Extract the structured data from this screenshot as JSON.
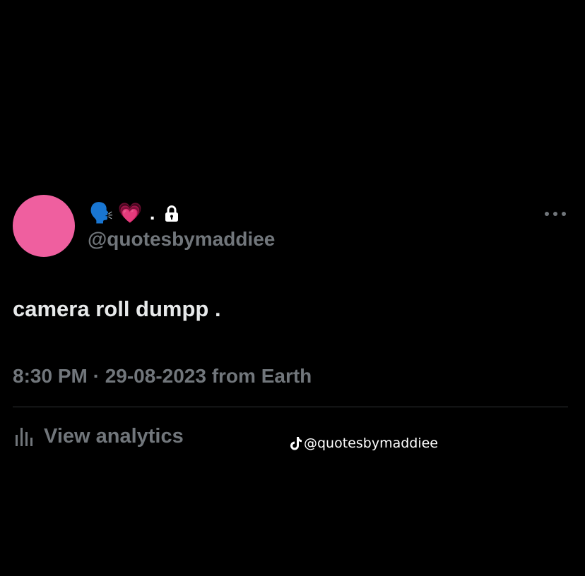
{
  "tweet": {
    "avatar_color": "#ef5f9f",
    "display_name": {
      "emoji_1": "🗣️",
      "emoji_2": "💗",
      "separator": "."
    },
    "handle": "@quotesbymaddiee",
    "text": "camera roll dumpp .",
    "meta": "8:30 PM · 29-08-2023 from Earth",
    "analytics_label": "View analytics"
  },
  "watermark": {
    "text": "@quotesbymaddiee"
  },
  "colors": {
    "background": "#000000",
    "primary_text": "#e7e9ea",
    "secondary_text": "#71767b",
    "divider": "#2f3336"
  },
  "icons": {
    "lock": "lock-icon",
    "more": "more-icon",
    "analytics": "analytics-icon",
    "tiktok": "tiktok-icon"
  }
}
